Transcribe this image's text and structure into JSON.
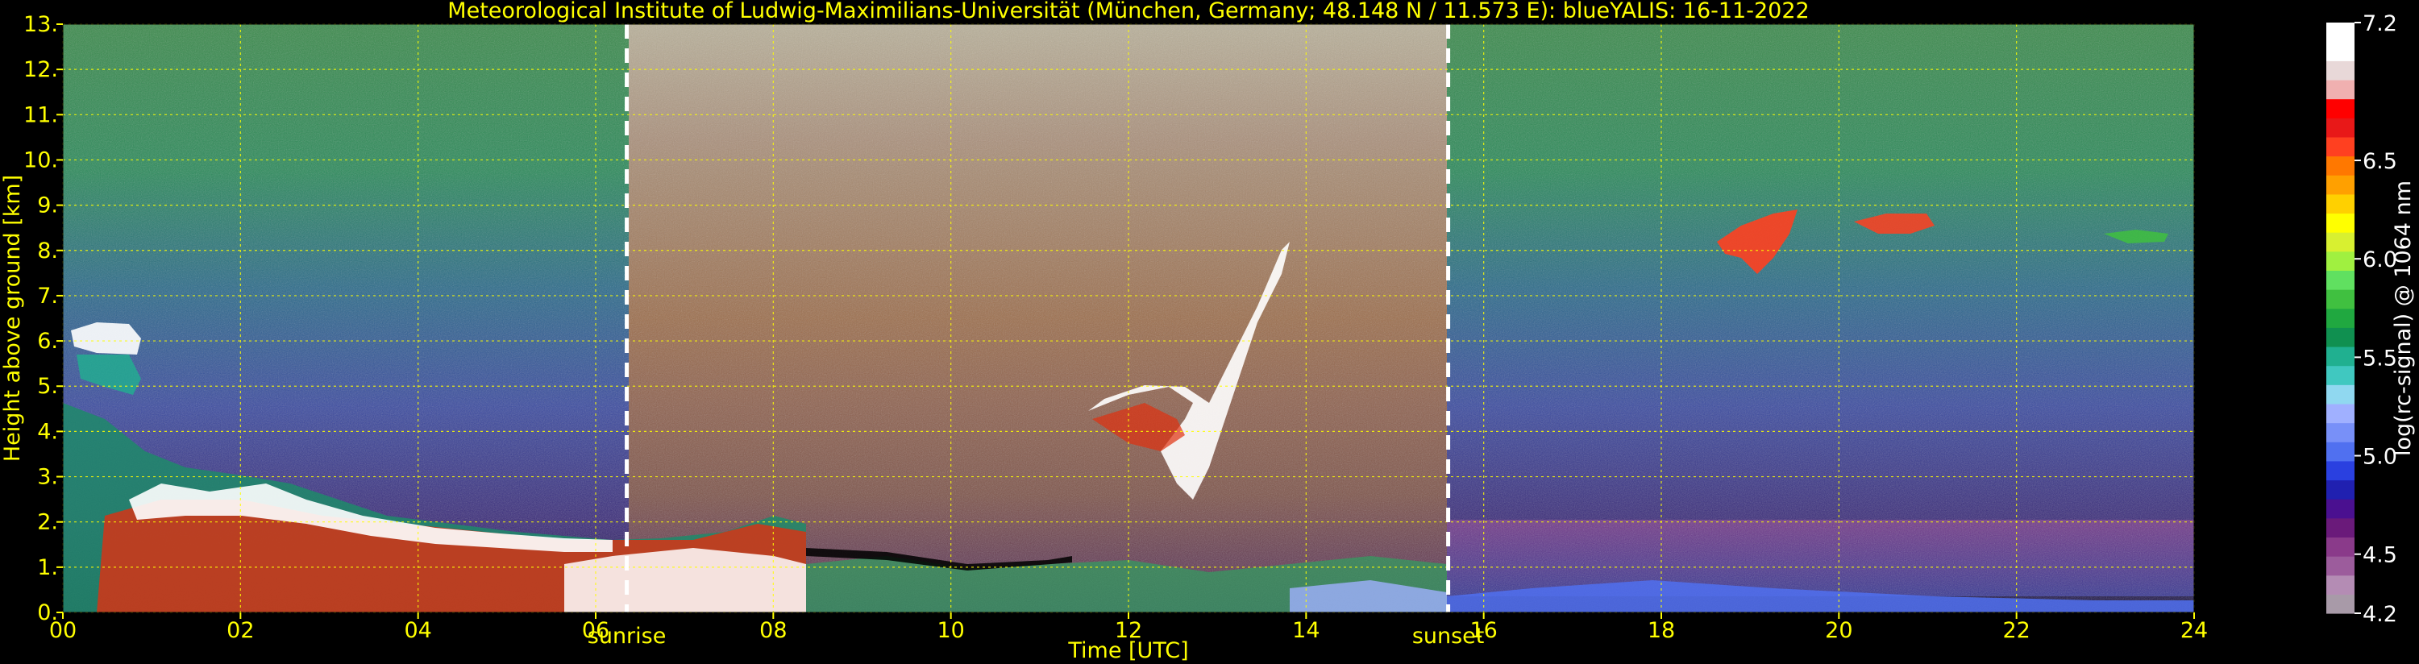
{
  "title": "Meteorological Institute of Ludwig-Maximilians-Universität (München, Germany; 48.148 N / 11.573 E):    blueYALIS: 16-11-2022",
  "chart_data": {
    "type": "heatmap",
    "title": "Meteorological Institute of Ludwig-Maximilians-Universität (München, Germany; 48.148 N / 11.573 E):    blueYALIS: 16-11-2022",
    "xlabel": "Time [UTC]",
    "ylabel": "Height above ground [km]",
    "xlim": [
      0,
      24
    ],
    "ylim": [
      0,
      13
    ],
    "x_ticks": [
      {
        "v": 0,
        "label": "00"
      },
      {
        "v": 2,
        "label": "02"
      },
      {
        "v": 4,
        "label": "04"
      },
      {
        "v": 6,
        "label": "06"
      },
      {
        "v": 8,
        "label": "08"
      },
      {
        "v": 10,
        "label": "10"
      },
      {
        "v": 12,
        "label": "12"
      },
      {
        "v": 14,
        "label": "14"
      },
      {
        "v": 16,
        "label": "16"
      },
      {
        "v": 18,
        "label": "18"
      },
      {
        "v": 20,
        "label": "20"
      },
      {
        "v": 22,
        "label": "22"
      },
      {
        "v": 24,
        "label": "24"
      }
    ],
    "y_ticks": [
      {
        "v": 0,
        "label": "0."
      },
      {
        "v": 1,
        "label": "1."
      },
      {
        "v": 2,
        "label": "2."
      },
      {
        "v": 3,
        "label": "3."
      },
      {
        "v": 4,
        "label": "4."
      },
      {
        "v": 5,
        "label": "5."
      },
      {
        "v": 6,
        "label": "6."
      },
      {
        "v": 7,
        "label": "7."
      },
      {
        "v": 8,
        "label": "8."
      },
      {
        "v": 9,
        "label": "9."
      },
      {
        "v": 10,
        "label": "10."
      },
      {
        "v": 11,
        "label": "11."
      },
      {
        "v": 12,
        "label": "12."
      },
      {
        "v": 13,
        "label": "13."
      }
    ],
    "grid": true,
    "grid_color": "#ffff00",
    "annotations": [
      {
        "label": "sunrise",
        "x": 6.35
      },
      {
        "label": "sunset",
        "x": 15.6
      }
    ],
    "colorbar": {
      "label": "log(rc-signal) @ 1064 nm",
      "range": [
        4.2,
        7.2
      ],
      "ticks": [
        {
          "v": 4.2,
          "label": "4.2"
        },
        {
          "v": 4.5,
          "label": "4.5"
        },
        {
          "v": 5.0,
          "label": "5.0"
        },
        {
          "v": 5.5,
          "label": "5.5"
        },
        {
          "v": 6.0,
          "label": "6.0"
        },
        {
          "v": 6.5,
          "label": "6.5"
        },
        {
          "v": 7.2,
          "label": "7.2"
        }
      ],
      "colors": [
        "#a89aa8",
        "#b48cb4",
        "#9c5c9c",
        "#8a3a8a",
        "#6a1a7a",
        "#4a1090",
        "#2020b0",
        "#2a40e0",
        "#5070f0",
        "#7890f8",
        "#a0b0ff",
        "#90d8f0",
        "#40c8c0",
        "#20b090",
        "#109050",
        "#20a840",
        "#40c040",
        "#60e060",
        "#a0f040",
        "#d8f030",
        "#ffff00",
        "#ffd000",
        "#ffa000",
        "#ff7800",
        "#ff4020",
        "#e81818",
        "#ff0000",
        "#f0b0b0",
        "#e8d8d8",
        "#ffffff",
        "#ffffff"
      ]
    },
    "features": [
      {
        "name": "sunrise",
        "x": 6.35
      },
      {
        "name": "sunset",
        "x": 15.6
      }
    ]
  },
  "colors": {
    "text": "#ffff00",
    "grid": "#ffff00",
    "markers": "#ffffff"
  }
}
